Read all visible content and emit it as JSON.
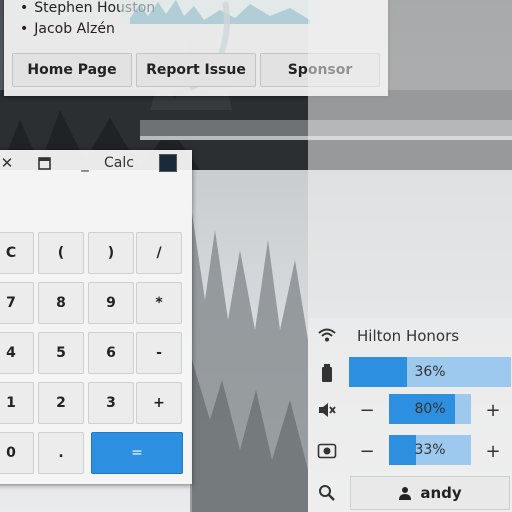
{
  "about": {
    "credits": [
      "Stephen Houston",
      "Jacob Alzén"
    ],
    "buttons": {
      "home": "Home Page",
      "report": "Report Issue",
      "sponsor": "Sponsor"
    }
  },
  "calc": {
    "title": "Calc",
    "keys": [
      [
        "C",
        "(",
        ")",
        "/"
      ],
      [
        "7",
        "8",
        "9",
        "*"
      ],
      [
        "4",
        "5",
        "6",
        "-"
      ],
      [
        "1",
        "2",
        "3",
        "+"
      ],
      [
        "0",
        ".",
        "="
      ]
    ]
  },
  "system": {
    "network_name": "Hilton Honors",
    "battery": {
      "label": "36%",
      "value": 0.36
    },
    "volume": {
      "label": "80%",
      "value": 0.8,
      "minus": "−",
      "plus": "+"
    },
    "brightness": {
      "label": "33%",
      "value": 0.33,
      "minus": "−",
      "plus": "+"
    },
    "user": "andy"
  },
  "colors": {
    "accent": "#2d8fe0",
    "accent_track": "#9ec9ef"
  }
}
